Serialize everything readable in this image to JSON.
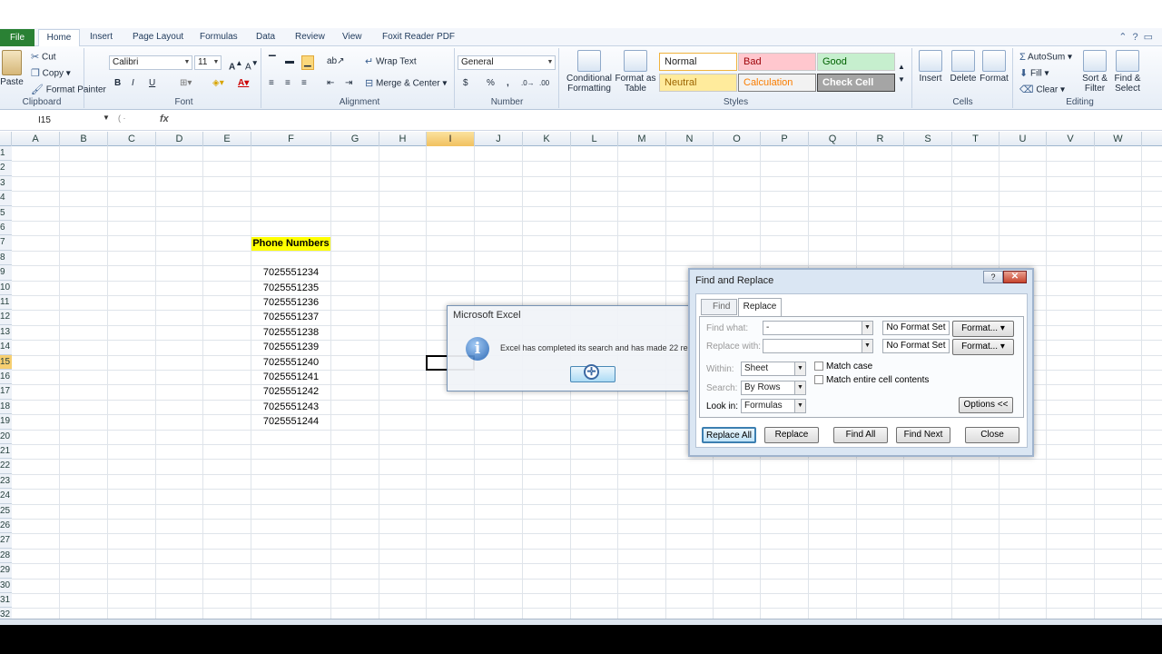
{
  "tabs": [
    "File",
    "Home",
    "Insert",
    "Page Layout",
    "Formulas",
    "Data",
    "Review",
    "View",
    "Foxit Reader PDF"
  ],
  "clipboard": {
    "paste": "Paste",
    "cut": "Cut",
    "copy": "Copy",
    "painter": "Format Painter",
    "label": "Clipboard"
  },
  "font": {
    "name": "Calibri",
    "size": "11",
    "bold": "B",
    "italic": "I",
    "underline": "U",
    "label": "Font"
  },
  "alignment": {
    "wrap": "Wrap Text",
    "merge": "Merge & Center",
    "label": "Alignment"
  },
  "number": {
    "format": "General",
    "currency": "$",
    "percent": "%",
    "comma": ",",
    "label": "Number"
  },
  "styles": {
    "conditional": "Conditional Formatting",
    "table": "Format as Table",
    "normal": "Normal",
    "bad": "Bad",
    "good": "Good",
    "neutral": "Neutral",
    "calculation": "Calculation",
    "check": "Check Cell",
    "label": "Styles"
  },
  "cells": {
    "insert": "Insert",
    "delete": "Delete",
    "format": "Format",
    "label": "Cells"
  },
  "editing": {
    "autosum": "AutoSum",
    "fill": "Fill",
    "clear": "Clear",
    "sort": "Sort & Filter",
    "find": "Find & Select",
    "label": "Editing"
  },
  "formula_bar": {
    "name_box": "I15",
    "fx": "fx",
    "formula": ""
  },
  "columns": [
    "A",
    "B",
    "C",
    "D",
    "E",
    "F",
    "G",
    "H",
    "I",
    "J",
    "K",
    "L",
    "M",
    "N",
    "O",
    "P",
    "Q",
    "R",
    "S",
    "T",
    "U",
    "V",
    "W"
  ],
  "rows": [
    "1",
    "2",
    "3",
    "4",
    "5",
    "6",
    "7",
    "8",
    "9",
    "10",
    "11",
    "12",
    "13",
    "14",
    "15",
    "16",
    "17",
    "18",
    "19",
    "20",
    "21",
    "22",
    "23",
    "24",
    "25",
    "26",
    "27",
    "28",
    "29",
    "30",
    "31",
    "32"
  ],
  "header_cell": "Phone Numbers",
  "phones": [
    "7025551234",
    "7025551235",
    "7025551236",
    "7025551237",
    "7025551238",
    "7025551239",
    "7025551240",
    "7025551241",
    "7025551242",
    "7025551243",
    "7025551244"
  ],
  "msgbox": {
    "title": "Microsoft Excel",
    "message": "Excel has completed its search and has made 22 replacements.",
    "ok": "OK"
  },
  "find_replace": {
    "title": "Find and Replace",
    "tab_find": "Find",
    "tab_replace": "Replace",
    "find_label": "Find what:",
    "find_value": "-",
    "replace_label": "Replace with:",
    "replace_value": "",
    "no_format": "No Format Set",
    "format_btn": "Format...",
    "within_label": "Within:",
    "within_value": "Sheet",
    "search_label": "Search:",
    "search_value": "By Rows",
    "lookin_label": "Look in:",
    "lookin_value": "Formulas",
    "match_case": "Match case",
    "match_entire": "Match entire cell contents",
    "options": "Options <<",
    "replace_all": "Replace All",
    "replace": "Replace",
    "find_all": "Find All",
    "find_next": "Find Next",
    "close": "Close"
  },
  "colors": {
    "file_tab": "#2a8134",
    "header_fill": "#ffff00",
    "selection": "#f6cf71"
  }
}
